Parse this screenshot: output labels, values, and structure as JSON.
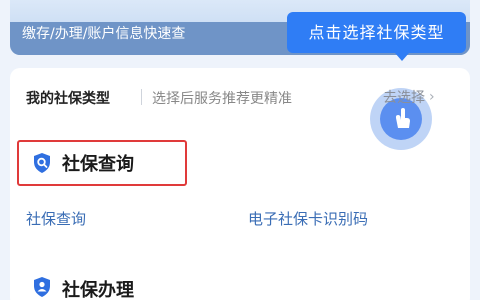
{
  "banner": {
    "text": "缴存/办理/账户信息快速查"
  },
  "tooltip": {
    "text": "点击选择社保类型"
  },
  "insurance_type": {
    "title": "我的社保类型",
    "hint": "选择后服务推荐更精准",
    "action": "去选择"
  },
  "sections": [
    {
      "title": "社保查询",
      "links": [
        "社保查询",
        "电子社保卡识别码"
      ]
    },
    {
      "title": "社保办理"
    }
  ],
  "colors": {
    "accent": "#2f7df5",
    "highlight_border": "#e03a3a",
    "link": "#3a6db5",
    "icon": "#2f6fe0"
  },
  "icons": [
    "search-shield-icon",
    "person-shield-icon",
    "chevron-right-icon",
    "tap-finger-icon"
  ]
}
